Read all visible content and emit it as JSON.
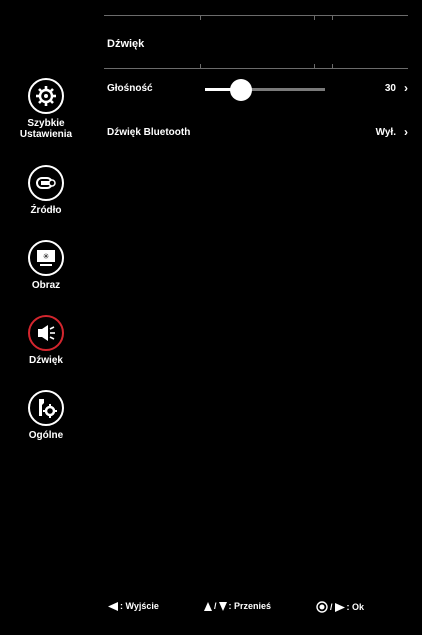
{
  "sidebar": {
    "items": [
      {
        "label": "Szybkie\nUstawienia",
        "icon": "quick-settings-gear-icon"
      },
      {
        "label": "Źródło",
        "icon": "input-source-icon"
      },
      {
        "label": "Obraz",
        "icon": "picture-icon"
      },
      {
        "label": "Dźwięk",
        "icon": "speaker-icon",
        "active": true
      },
      {
        "label": "Ogólne",
        "icon": "general-tools-icon"
      }
    ]
  },
  "main": {
    "title": "Dźwięk",
    "rows": [
      {
        "label": "Głośność",
        "value": "30",
        "slider_fraction": 0.3
      },
      {
        "label": "Dźwięk Bluetooth",
        "value": "Wył."
      }
    ]
  },
  "footer": {
    "exit_label": ": Wyjście",
    "move_label": ": Przenieś",
    "ok_label": ": Ok"
  },
  "colors": {
    "active_ring": "#d3262e",
    "background": "#000000"
  }
}
